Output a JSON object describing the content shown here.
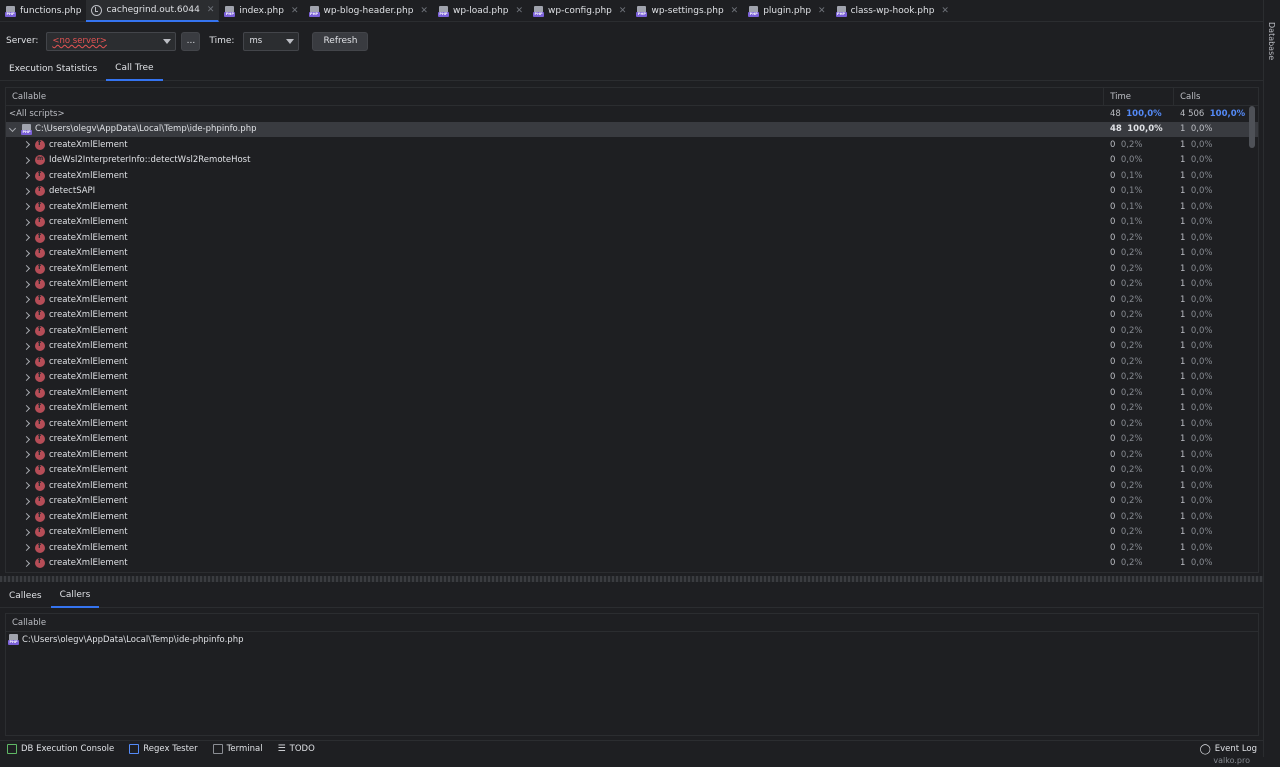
{
  "tabs": [
    {
      "label": "functions.php",
      "icon": "php-file-icon",
      "active": false,
      "closable": false
    },
    {
      "label": "cachegrind.out.6044",
      "icon": "clock-icon",
      "active": true,
      "closable": true
    },
    {
      "label": "index.php",
      "icon": "php-file-icon",
      "active": false,
      "closable": true
    },
    {
      "label": "wp-blog-header.php",
      "icon": "php-file-icon",
      "active": false,
      "closable": true
    },
    {
      "label": "wp-load.php",
      "icon": "php-file-icon",
      "active": false,
      "closable": true
    },
    {
      "label": "wp-config.php",
      "icon": "php-file-icon",
      "active": false,
      "closable": true
    },
    {
      "label": "wp-settings.php",
      "icon": "php-file-icon",
      "active": false,
      "closable": true
    },
    {
      "label": "plugin.php",
      "icon": "php-file-icon",
      "active": false,
      "closable": true
    },
    {
      "label": "class-wp-hook.php",
      "icon": "php-file-icon",
      "active": false,
      "closable": true
    }
  ],
  "right_strip": {
    "label": "Database"
  },
  "toolbar": {
    "server_label": "Server:",
    "server_value": "<no server>",
    "browse_label": "...",
    "time_label": "Time:",
    "time_value": "ms",
    "refresh_label": "Refresh"
  },
  "top_subtabs": [
    {
      "label": "Execution Statistics",
      "active": false
    },
    {
      "label": "Call Tree",
      "active": true
    }
  ],
  "call_tree": {
    "columns": {
      "callable": "Callable",
      "time": "Time",
      "calls": "Calls"
    },
    "all_row": {
      "label": "<All scripts>",
      "time": "48",
      "time_pct": "100,0%",
      "calls": "4 506",
      "calls_pct": "100,0%"
    },
    "root_row": {
      "label": "C:\\Users\\olegv\\AppData\\Local\\Temp\\ide-phpinfo.php",
      "time": "48",
      "time_pct": "100,0%",
      "calls": "1",
      "calls_pct": "0,0%"
    },
    "rows": [
      {
        "label": "createXmlElement",
        "time": "0",
        "time_pct": "0,2%",
        "calls": "1",
        "calls_pct": "0,0%",
        "kind": "function"
      },
      {
        "label": "IdeWsl2InterpreterInfo::detectWsl2RemoteHost",
        "time": "0",
        "time_pct": "0,0%",
        "calls": "1",
        "calls_pct": "0,0%",
        "kind": "method"
      },
      {
        "label": "createXmlElement",
        "time": "0",
        "time_pct": "0,1%",
        "calls": "1",
        "calls_pct": "0,0%",
        "kind": "function"
      },
      {
        "label": "detectSAPI",
        "time": "0",
        "time_pct": "0,1%",
        "calls": "1",
        "calls_pct": "0,0%",
        "kind": "function"
      },
      {
        "label": "createXmlElement",
        "time": "0",
        "time_pct": "0,1%",
        "calls": "1",
        "calls_pct": "0,0%",
        "kind": "function"
      },
      {
        "label": "createXmlElement",
        "time": "0",
        "time_pct": "0,1%",
        "calls": "1",
        "calls_pct": "0,0%",
        "kind": "function"
      },
      {
        "label": "createXmlElement",
        "time": "0",
        "time_pct": "0,2%",
        "calls": "1",
        "calls_pct": "0,0%",
        "kind": "function"
      },
      {
        "label": "createXmlElement",
        "time": "0",
        "time_pct": "0,2%",
        "calls": "1",
        "calls_pct": "0,0%",
        "kind": "function"
      },
      {
        "label": "createXmlElement",
        "time": "0",
        "time_pct": "0,2%",
        "calls": "1",
        "calls_pct": "0,0%",
        "kind": "function"
      },
      {
        "label": "createXmlElement",
        "time": "0",
        "time_pct": "0,2%",
        "calls": "1",
        "calls_pct": "0,0%",
        "kind": "function"
      },
      {
        "label": "createXmlElement",
        "time": "0",
        "time_pct": "0,2%",
        "calls": "1",
        "calls_pct": "0,0%",
        "kind": "function"
      },
      {
        "label": "createXmlElement",
        "time": "0",
        "time_pct": "0,2%",
        "calls": "1",
        "calls_pct": "0,0%",
        "kind": "function"
      },
      {
        "label": "createXmlElement",
        "time": "0",
        "time_pct": "0,2%",
        "calls": "1",
        "calls_pct": "0,0%",
        "kind": "function"
      },
      {
        "label": "createXmlElement",
        "time": "0",
        "time_pct": "0,2%",
        "calls": "1",
        "calls_pct": "0,0%",
        "kind": "function"
      },
      {
        "label": "createXmlElement",
        "time": "0",
        "time_pct": "0,2%",
        "calls": "1",
        "calls_pct": "0,0%",
        "kind": "function"
      },
      {
        "label": "createXmlElement",
        "time": "0",
        "time_pct": "0,2%",
        "calls": "1",
        "calls_pct": "0,0%",
        "kind": "function"
      },
      {
        "label": "createXmlElement",
        "time": "0",
        "time_pct": "0,2%",
        "calls": "1",
        "calls_pct": "0,0%",
        "kind": "function"
      },
      {
        "label": "createXmlElement",
        "time": "0",
        "time_pct": "0,2%",
        "calls": "1",
        "calls_pct": "0,0%",
        "kind": "function"
      },
      {
        "label": "createXmlElement",
        "time": "0",
        "time_pct": "0,2%",
        "calls": "1",
        "calls_pct": "0,0%",
        "kind": "function"
      },
      {
        "label": "createXmlElement",
        "time": "0",
        "time_pct": "0,2%",
        "calls": "1",
        "calls_pct": "0,0%",
        "kind": "function"
      },
      {
        "label": "createXmlElement",
        "time": "0",
        "time_pct": "0,2%",
        "calls": "1",
        "calls_pct": "0,0%",
        "kind": "function"
      },
      {
        "label": "createXmlElement",
        "time": "0",
        "time_pct": "0,2%",
        "calls": "1",
        "calls_pct": "0,0%",
        "kind": "function"
      },
      {
        "label": "createXmlElement",
        "time": "0",
        "time_pct": "0,2%",
        "calls": "1",
        "calls_pct": "0,0%",
        "kind": "function"
      },
      {
        "label": "createXmlElement",
        "time": "0",
        "time_pct": "0,2%",
        "calls": "1",
        "calls_pct": "0,0%",
        "kind": "function"
      },
      {
        "label": "createXmlElement",
        "time": "0",
        "time_pct": "0,2%",
        "calls": "1",
        "calls_pct": "0,0%",
        "kind": "function"
      },
      {
        "label": "createXmlElement",
        "time": "0",
        "time_pct": "0,2%",
        "calls": "1",
        "calls_pct": "0,0%",
        "kind": "function"
      },
      {
        "label": "createXmlElement",
        "time": "0",
        "time_pct": "0,2%",
        "calls": "1",
        "calls_pct": "0,0%",
        "kind": "function"
      },
      {
        "label": "createXmlElement",
        "time": "0",
        "time_pct": "0,2%",
        "calls": "1",
        "calls_pct": "0,0%",
        "kind": "function"
      }
    ]
  },
  "bottom_subtabs": [
    {
      "label": "Callees",
      "active": false
    },
    {
      "label": "Callers",
      "active": true
    }
  ],
  "callers": {
    "column": "Callable",
    "rows": [
      {
        "label": "C:\\Users\\olegv\\AppData\\Local\\Temp\\ide-phpinfo.php"
      }
    ]
  },
  "statusbar": {
    "items": [
      {
        "label": "DB Execution Console",
        "icon": "db-console-icon"
      },
      {
        "label": "Regex Tester",
        "icon": "regex-icon"
      },
      {
        "label": "Terminal",
        "icon": "terminal-icon"
      },
      {
        "label": "TODO",
        "icon": "todo-list-icon"
      }
    ],
    "event_log": "Event Log",
    "vcs_branch": "valko.pro"
  },
  "colors": {
    "accent": "#3574f0",
    "percent": "#548af7",
    "function_icon": "#b64d57",
    "php_badge": "#7b61d8",
    "error": "#e55353"
  }
}
